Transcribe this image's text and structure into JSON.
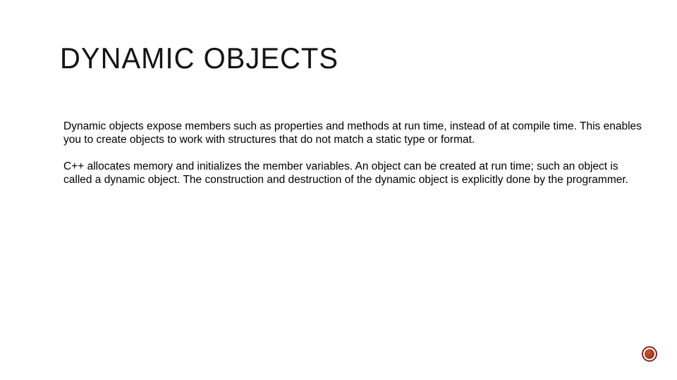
{
  "title": "DYNAMIC OBJECTS",
  "paragraphs": [
    "Dynamic objects expose members such as properties and methods at run time, instead of at compile time. This enables you to create objects to work with structures that do not match a static type or format.",
    " C++ allocates memory and initializes the member variables. An object can be created at run time; such an object is called a dynamic object. The construction and destruction of the dynamic object is explicitly done by the programmer."
  ],
  "decoration": {
    "icon": "circle-dot-icon",
    "outer_color": "#7a2e1a",
    "inner_color": "#a8381e"
  }
}
